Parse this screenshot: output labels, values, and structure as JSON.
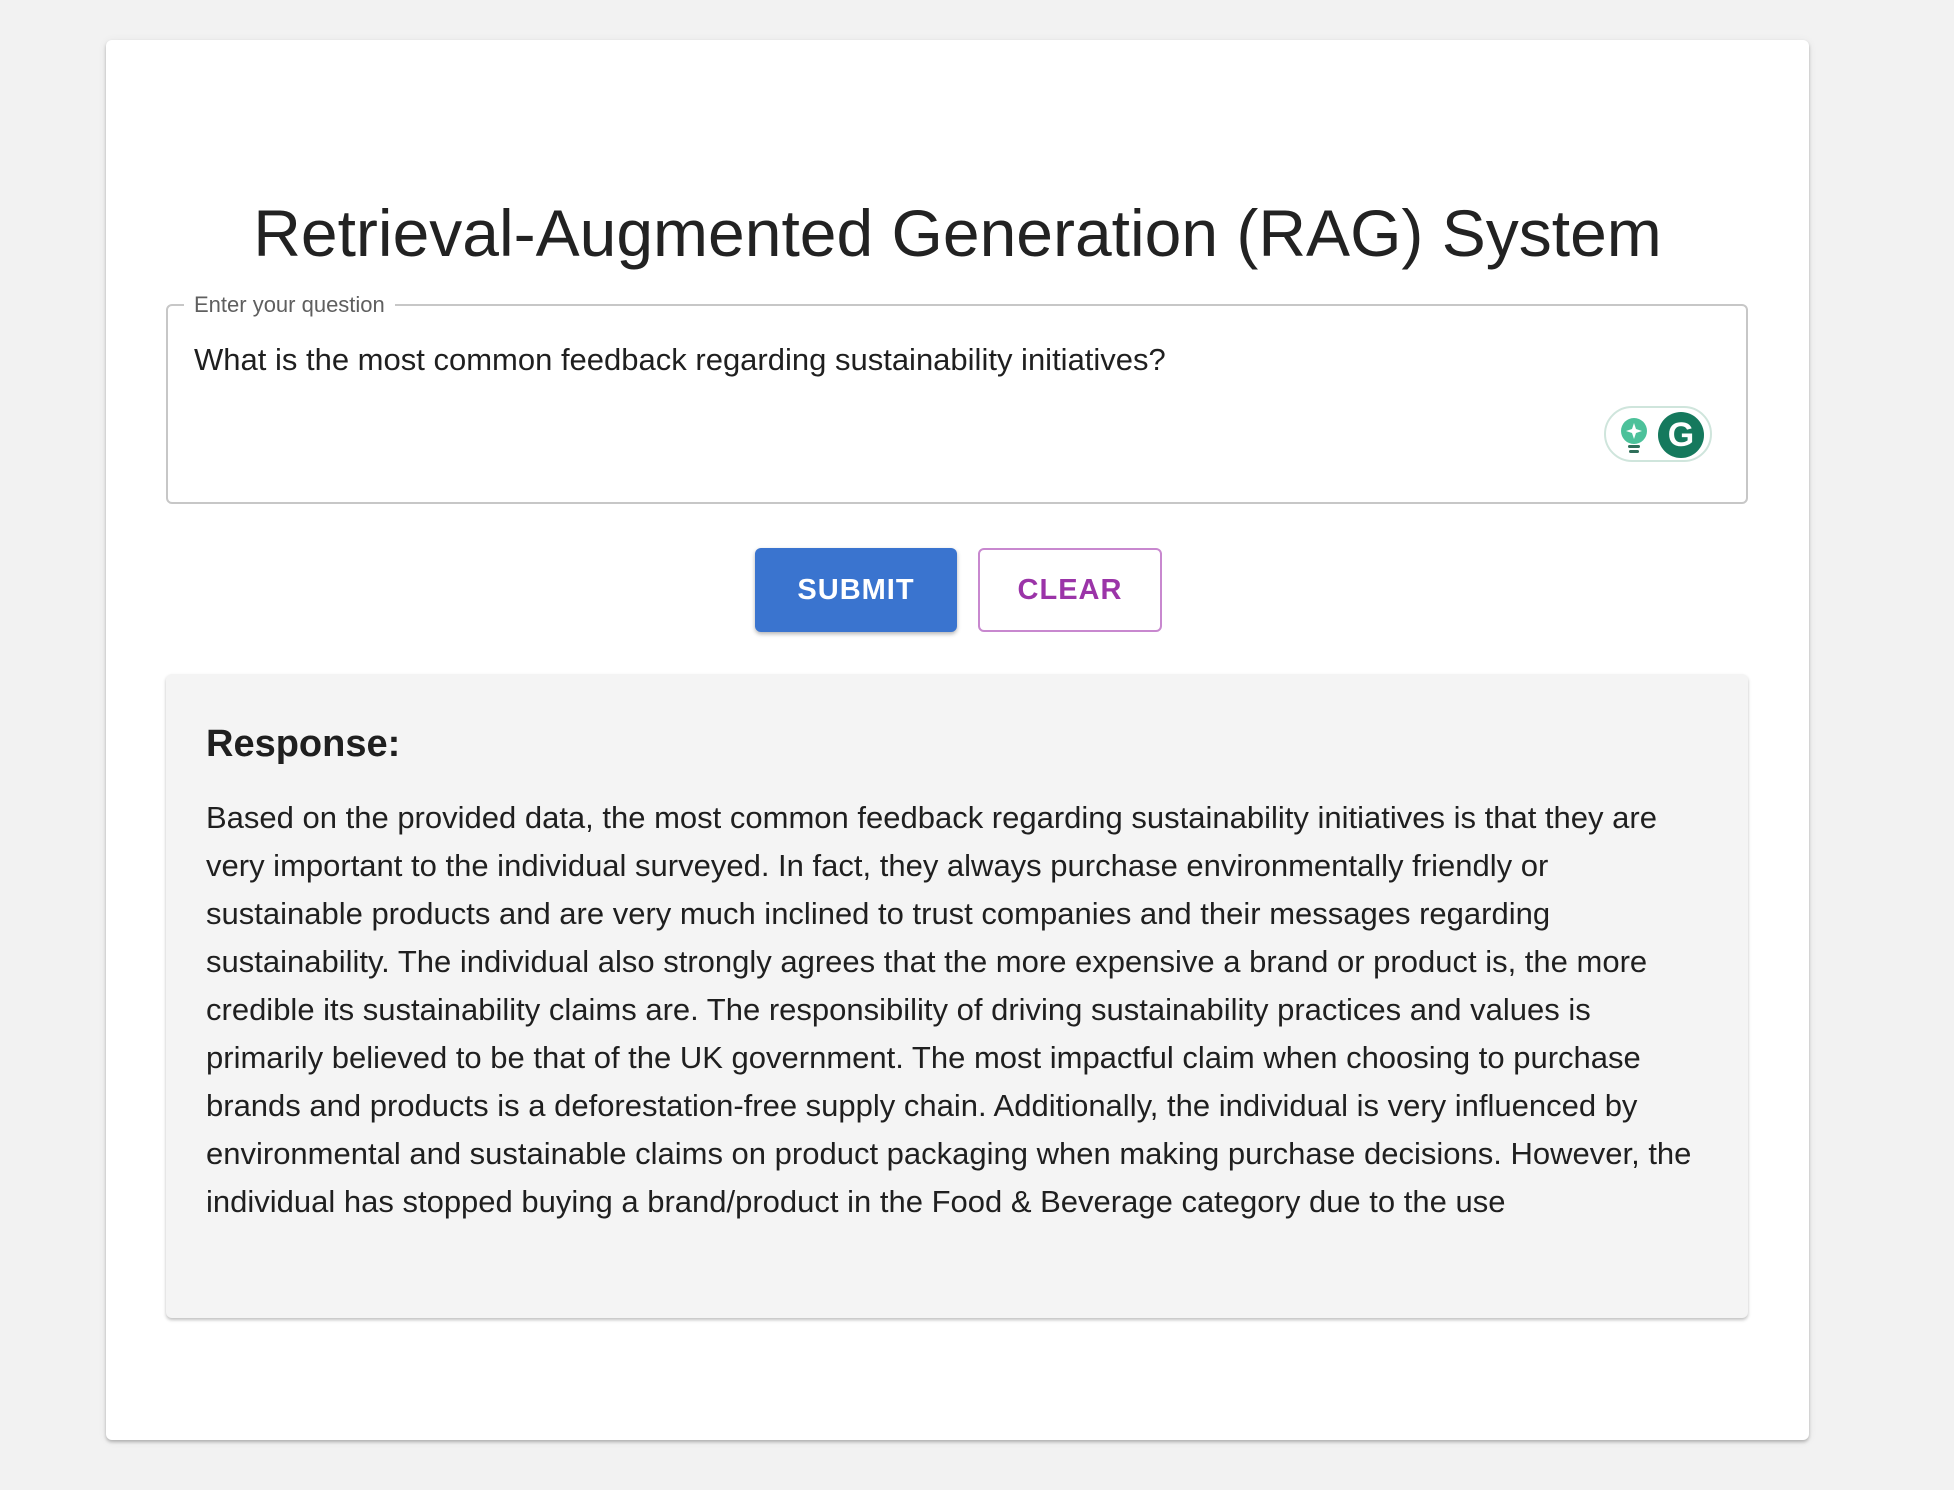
{
  "page": {
    "title": "Retrieval-Augmented Generation (RAG) System"
  },
  "question_field": {
    "label": "Enter your question",
    "value": "What is the most common feedback regarding sustainability initiatives?"
  },
  "grammarly_widget": {
    "letter": "G",
    "icons": [
      "lightbulb-icon",
      "grammarly-logo-icon"
    ]
  },
  "actions": {
    "submit_label": "SUBMIT",
    "clear_label": "CLEAR"
  },
  "response": {
    "heading": "Response:",
    "text": "Based on the provided data, the most common feedback regarding sustainability initiatives is that they are very important to the individual surveyed. In fact, they always purchase environmentally friendly or sustainable products and are very much inclined to trust companies and their messages regarding sustainability. The individual also strongly agrees that the more expensive a brand or product is, the more credible its sustainability claims are. The responsibility of driving sustainability practices and values is primarily believed to be that of the UK government. The most impactful claim when choosing to purchase brands and products is a deforestation-free supply chain. Additionally, the individual is very influenced by environmental and sustainable claims on product packaging when making purchase decisions. However, the individual has stopped buying a brand/product in the Food & Beverage category due to the use"
  },
  "colors": {
    "primary": "#3a74cf",
    "secondary": "#9b34a8",
    "background": "#f2f2f2",
    "response_background": "#f4f4f4",
    "grammarly_green": "#15795d"
  }
}
